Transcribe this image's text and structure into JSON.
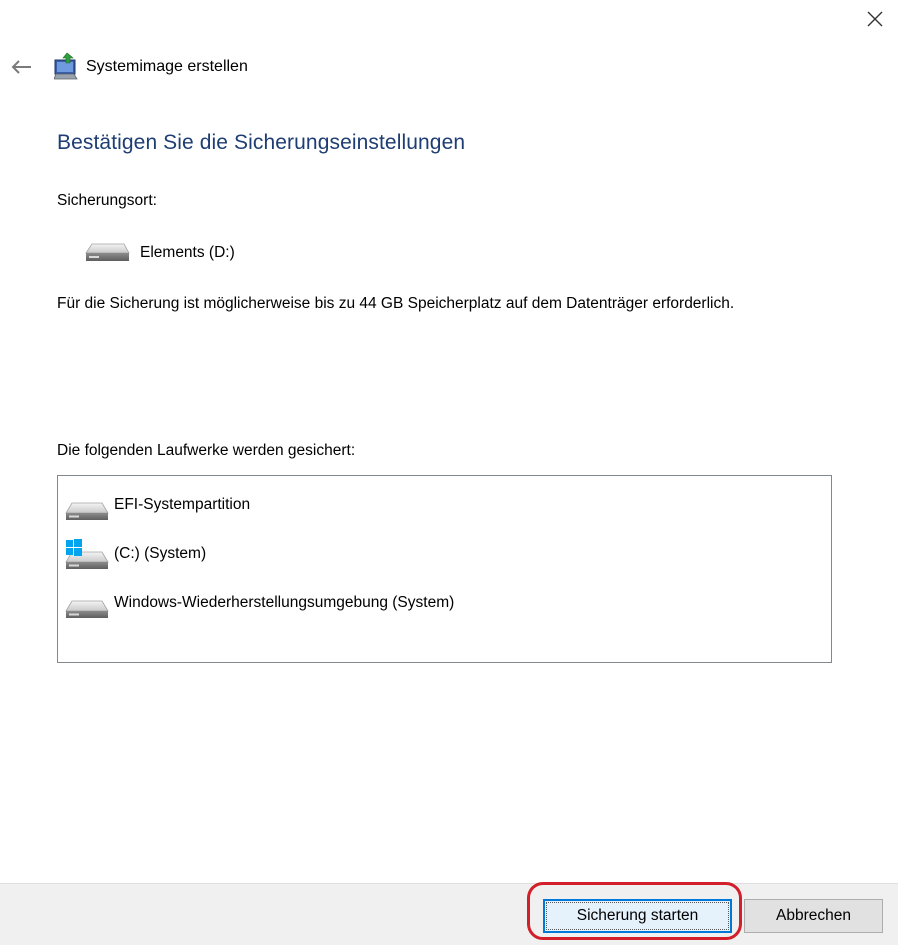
{
  "window": {
    "title": "Systemimage erstellen",
    "close_icon": "close-icon",
    "back_icon": "arrow-left-icon",
    "app_icon": "system-image-backup-icon"
  },
  "page": {
    "heading": "Bestätigen Sie die Sicherungseinstellungen",
    "location_label": "Sicherungsort:",
    "target_drive": {
      "name": "Elements (D:)",
      "icon": "hard-drive-icon"
    },
    "space_note": "Für die Sicherung ist möglicherweise bis zu 44 GB Speicherplatz auf dem Datenträger erforderlich.",
    "drives_label": "Die folgenden Laufwerke werden gesichert:",
    "drives": [
      {
        "name": "EFI-Systempartition",
        "icon": "hard-drive-icon"
      },
      {
        "name": "(C:) (System)",
        "icon": "windows-drive-icon"
      },
      {
        "name": "Windows-Wiederherstellungsumgebung (System)",
        "icon": "hard-drive-icon"
      }
    ]
  },
  "footer": {
    "start_label": "Sicherung starten",
    "cancel_label": "Abbrechen"
  },
  "colors": {
    "heading": "#1e3d73",
    "focus_border": "#0078d7",
    "highlight_ring": "#d21f2a",
    "footer_bg": "#f0f0f0"
  }
}
